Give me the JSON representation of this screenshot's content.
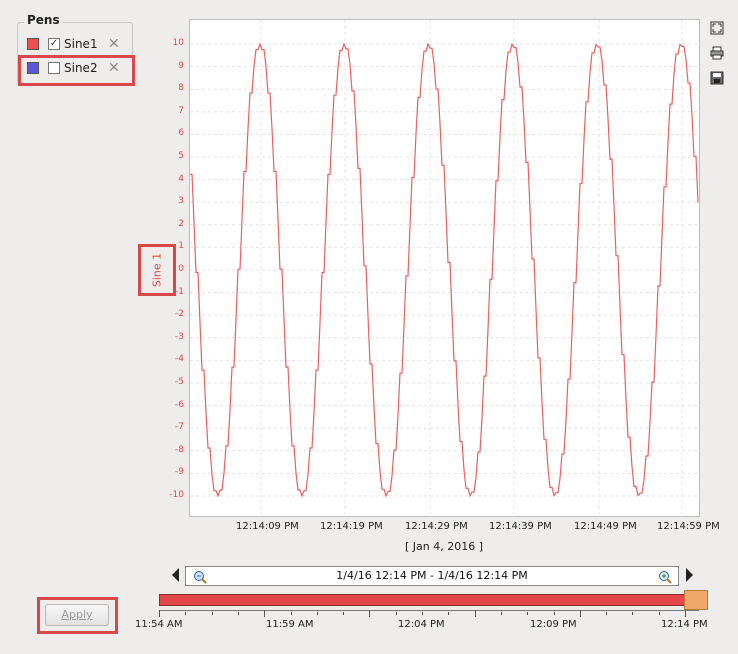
{
  "pens": {
    "title": "Pens",
    "items": [
      {
        "label": "Sine1",
        "color": "#f05050",
        "checked": true
      },
      {
        "label": "Sine2",
        "color": "#5a5ad8",
        "checked": false
      }
    ]
  },
  "chart_data": {
    "type": "line",
    "title": "",
    "xlabel": "[ Jan 4, 2016 ]",
    "ylabel": "Sine 1",
    "ylim": [
      -10,
      10
    ],
    "yticks": [
      10,
      9,
      8,
      7,
      6,
      5,
      4,
      3,
      2,
      1,
      0,
      -1,
      -2,
      -3,
      -4,
      -5,
      -6,
      -7,
      -8,
      -9,
      -10
    ],
    "xticks": [
      "12:14:09 PM",
      "12:14:19 PM",
      "12:14:29 PM",
      "12:14:39 PM",
      "12:14:49 PM",
      "12:14:59 PM"
    ],
    "grid": true,
    "series": [
      {
        "name": "Sine 1",
        "color": "#e86060",
        "amplitude": 10,
        "period_s": 10,
        "x_start": "12:14:00 PM",
        "x_end": "12:15:00 PM"
      }
    ]
  },
  "toolbar": {
    "icons": [
      "fit-to-view-icon",
      "print-icon",
      "save-icon"
    ]
  },
  "range": {
    "text": "1/4/16 12:14 PM - 1/4/16 12:14 PM"
  },
  "timeline": {
    "labels": [
      "11:54 AM",
      "11:59 AM",
      "12:04 PM",
      "12:09 PM",
      "12:14 PM"
    ]
  },
  "apply": {
    "label": "Apply"
  }
}
